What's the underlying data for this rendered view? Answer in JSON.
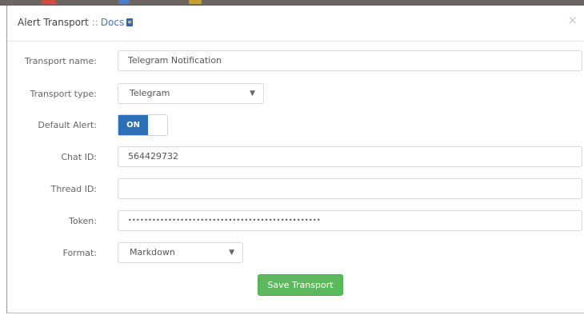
{
  "modal": {
    "title": "Alert Transport",
    "separator": "::",
    "docs_link": "Docs",
    "close": "×"
  },
  "form": {
    "transport_name": {
      "label": "Transport name:",
      "value": "Telegram Notification"
    },
    "transport_type": {
      "label": "Transport type:",
      "value": "Telegram"
    },
    "default_alert": {
      "label": "Default Alert:",
      "state": "ON"
    },
    "chat_id": {
      "label": "Chat ID:",
      "value": "564429732"
    },
    "thread_id": {
      "label": "Thread ID:",
      "value": ""
    },
    "token": {
      "label": "Token:",
      "value": "••••••••••••••••••••••••••••••••••••••••••••••••"
    },
    "format": {
      "label": "Format:",
      "value": "Markdown"
    }
  },
  "actions": {
    "save_label": "Save Transport"
  },
  "colors": {
    "primary": "#2d6fb7",
    "success": "#5cb85c",
    "link": "#3a7abf"
  },
  "icons": {
    "docs": "book-icon",
    "close": "close-icon",
    "dropdown": "chevron-down-icon"
  }
}
